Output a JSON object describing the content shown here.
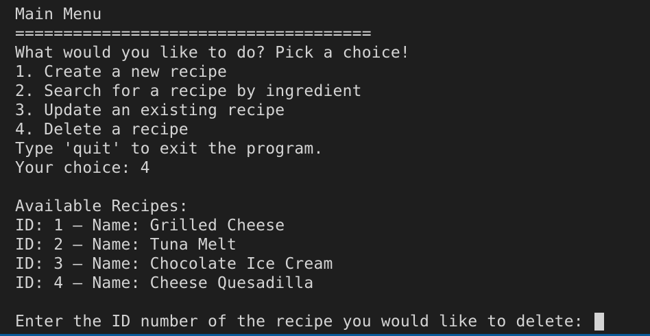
{
  "terminal": {
    "menu_title": "Main Menu",
    "separator": "=====================================",
    "prompt_question": "What would you like to do? Pick a choice!",
    "options": [
      "1. Create a new recipe",
      "2. Search for a recipe by ingredient",
      "3. Update an existing recipe",
      "4. Delete a recipe"
    ],
    "quit_hint": "Type 'quit' to exit the program.",
    "choice_line": "Your choice: 4",
    "recipes_header": "Available Recipes:",
    "recipes": [
      "ID: 1 – Name: Grilled Cheese",
      "ID: 2 – Name: Tuna Melt",
      "ID: 3 – Name: Chocolate Ice Cream",
      "ID: 4 – Name: Cheese Quesadilla"
    ],
    "delete_prompt": "Enter the ID number of the recipe you would like to delete: "
  },
  "colors": {
    "background": "#1e1e1e",
    "text": "#d4d4d4",
    "accent_bar": "#0a5a99"
  }
}
